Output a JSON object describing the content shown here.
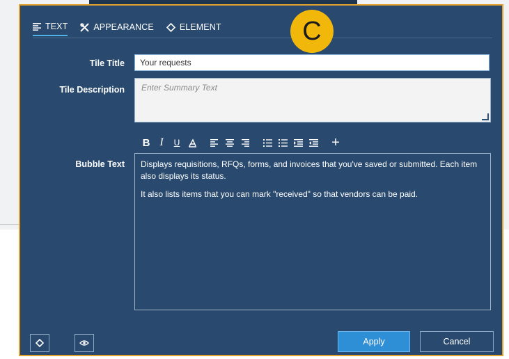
{
  "tabs": [
    {
      "label": "TEXT",
      "icon": "align-left-icon",
      "active": true
    },
    {
      "label": "APPEARANCE",
      "icon": "tools-icon",
      "active": false
    },
    {
      "label": "ELEMENT",
      "icon": "diamond-icon",
      "active": false
    }
  ],
  "step_badge": "C",
  "fields": {
    "tile_title_label": "Tile Title",
    "tile_title_value": "Your requests",
    "tile_description_label": "Tile Description",
    "tile_description_placeholder": "Enter Summary Text",
    "bubble_text_label": "Bubble Text"
  },
  "toolbar": {
    "bold": "B",
    "italic": "I",
    "underline": "U",
    "add": "+",
    "icons": [
      "bold-icon",
      "italic-icon",
      "underline-icon",
      "clear-format-icon",
      "align-left-icon",
      "align-center-icon",
      "align-right-icon",
      "bulleted-list-icon",
      "numbered-list-icon",
      "indent-icon",
      "outdent-icon",
      "add-icon"
    ]
  },
  "bubble_text": {
    "paragraph1": "Displays requisitions, RFQs, forms, and invoices that you've saved or submitted. Each item also displays its status.",
    "paragraph2": "It also lists items that you can mark \"received\" so that vendors can be paid."
  },
  "footer": {
    "apply_label": "Apply",
    "cancel_label": "Cancel",
    "left_icons": [
      "target-icon",
      "eye-icon"
    ]
  },
  "colors": {
    "dialog_bg": "#294a6e",
    "dialog_border": "#e2a22b",
    "badge": "#f1b70b",
    "apply_button": "#2f8fd6",
    "active_tab_underline": "#4fb3ea"
  }
}
